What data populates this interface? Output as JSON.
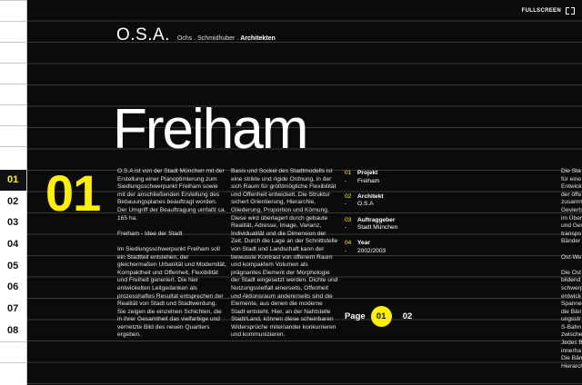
{
  "top": {
    "fullscreen_label": "FULLSCREEN"
  },
  "brand": {
    "logo": "O.S.A.",
    "partners": "Ochs . Schmidhuber . ",
    "suffix": "Architekten"
  },
  "project": {
    "title": "Freiham",
    "number": "01"
  },
  "nav": {
    "items": [
      "01",
      "02",
      "03",
      "04",
      "05",
      "06",
      "07",
      "08"
    ],
    "active_index": 0
  },
  "text": {
    "col1": [
      "O.S.A ist von der Stadt München mit der Erstellung einer Planoptimierung zum Siedlungsschwerpunkt Freiham sowie mit der anschließenden Erstellung des Bebauungsplanes beauftragt worden. Der Umgriff der Beauftragung umfaßt ca. 165 ha.",
      "Freiham - Idee der Stadt",
      "Im Siedlungsschwerpunkt Freiham soll ein Stadtteil entstehen, der gleichermaßen Urbanität und Modernität, Kompaktheit und Offenheit, Flexibilität und Freiheit generiert. Die hier entwickelten Leitgedanken als prozesshaftes Resultat entsprechen der Realität von Stadt und Stadtwerdung. Sie zeigen die einzelnen Schichten, die in ihrer Gesamtheit das vielfarbige und vernetzte Bild des neuen Quartiers ergeben."
    ],
    "col2": "Basis und Sockel des Stadtmodells ist eine strikte und rigide Ordnung, in der sich Raum für größtmögliche Flexibilität und Offenheit entwickelt. Die Struktur sichert Orientierung, Hierarchie, Gliederung, Proportion und Körnung. Diese wird überlagert durch gebaute Realität, Adresse, Image, Varianz, Individualität und die Dimension der Zeit. Durch die Lage an der Schnittstelle von Stadt und Landschaft kann der bewusste Kontrast von offenem Raum und kompaktem Volumen als prägnantes Element der Morphologie der Stadt eingesetzt werden. Dichte und Nutzungsvielfalt einerseits, Offenheit und Aktionsraum andererseits sind die Elemente, aus denen die moderne Stadt entsteht. Hier, an der Nahtstelle Stadt/Land, können diese scheinbaren Widersprüche miteinander konkurrieren und kommunizieren.",
    "col5": [
      "Die Sta",
      "für eine",
      "Entwick",
      "der öffe",
      "zusamm",
      "Gevierts",
      "im Über",
      "und Gev",
      "transpo",
      "Bänder",
      "",
      "Ost-We",
      "",
      "Die Ost",
      "bildend",
      "schwerp",
      "entwick",
      "Spanne",
      "die Bän",
      "ungsstr",
      "S-Bahn",
      "zwische",
      "Jedes B",
      "innerha",
      "Die Bän",
      "Hierarch"
    ]
  },
  "info": [
    {
      "num": "01",
      "label": "Projekt",
      "value": "Freiham"
    },
    {
      "num": "02",
      "label": "Architekt",
      "value": "O.S.A"
    },
    {
      "num": "03",
      "label": "Auftraggeber",
      "value": "Stadt München"
    },
    {
      "num": "04",
      "label": "Year",
      "value": "2002/2003"
    }
  ],
  "pager": {
    "label": "Page",
    "current": "01",
    "next": "02"
  },
  "colors": {
    "accent": "#ffef00",
    "background": "#0b0b0b",
    "sidebar": "#ffffff"
  }
}
